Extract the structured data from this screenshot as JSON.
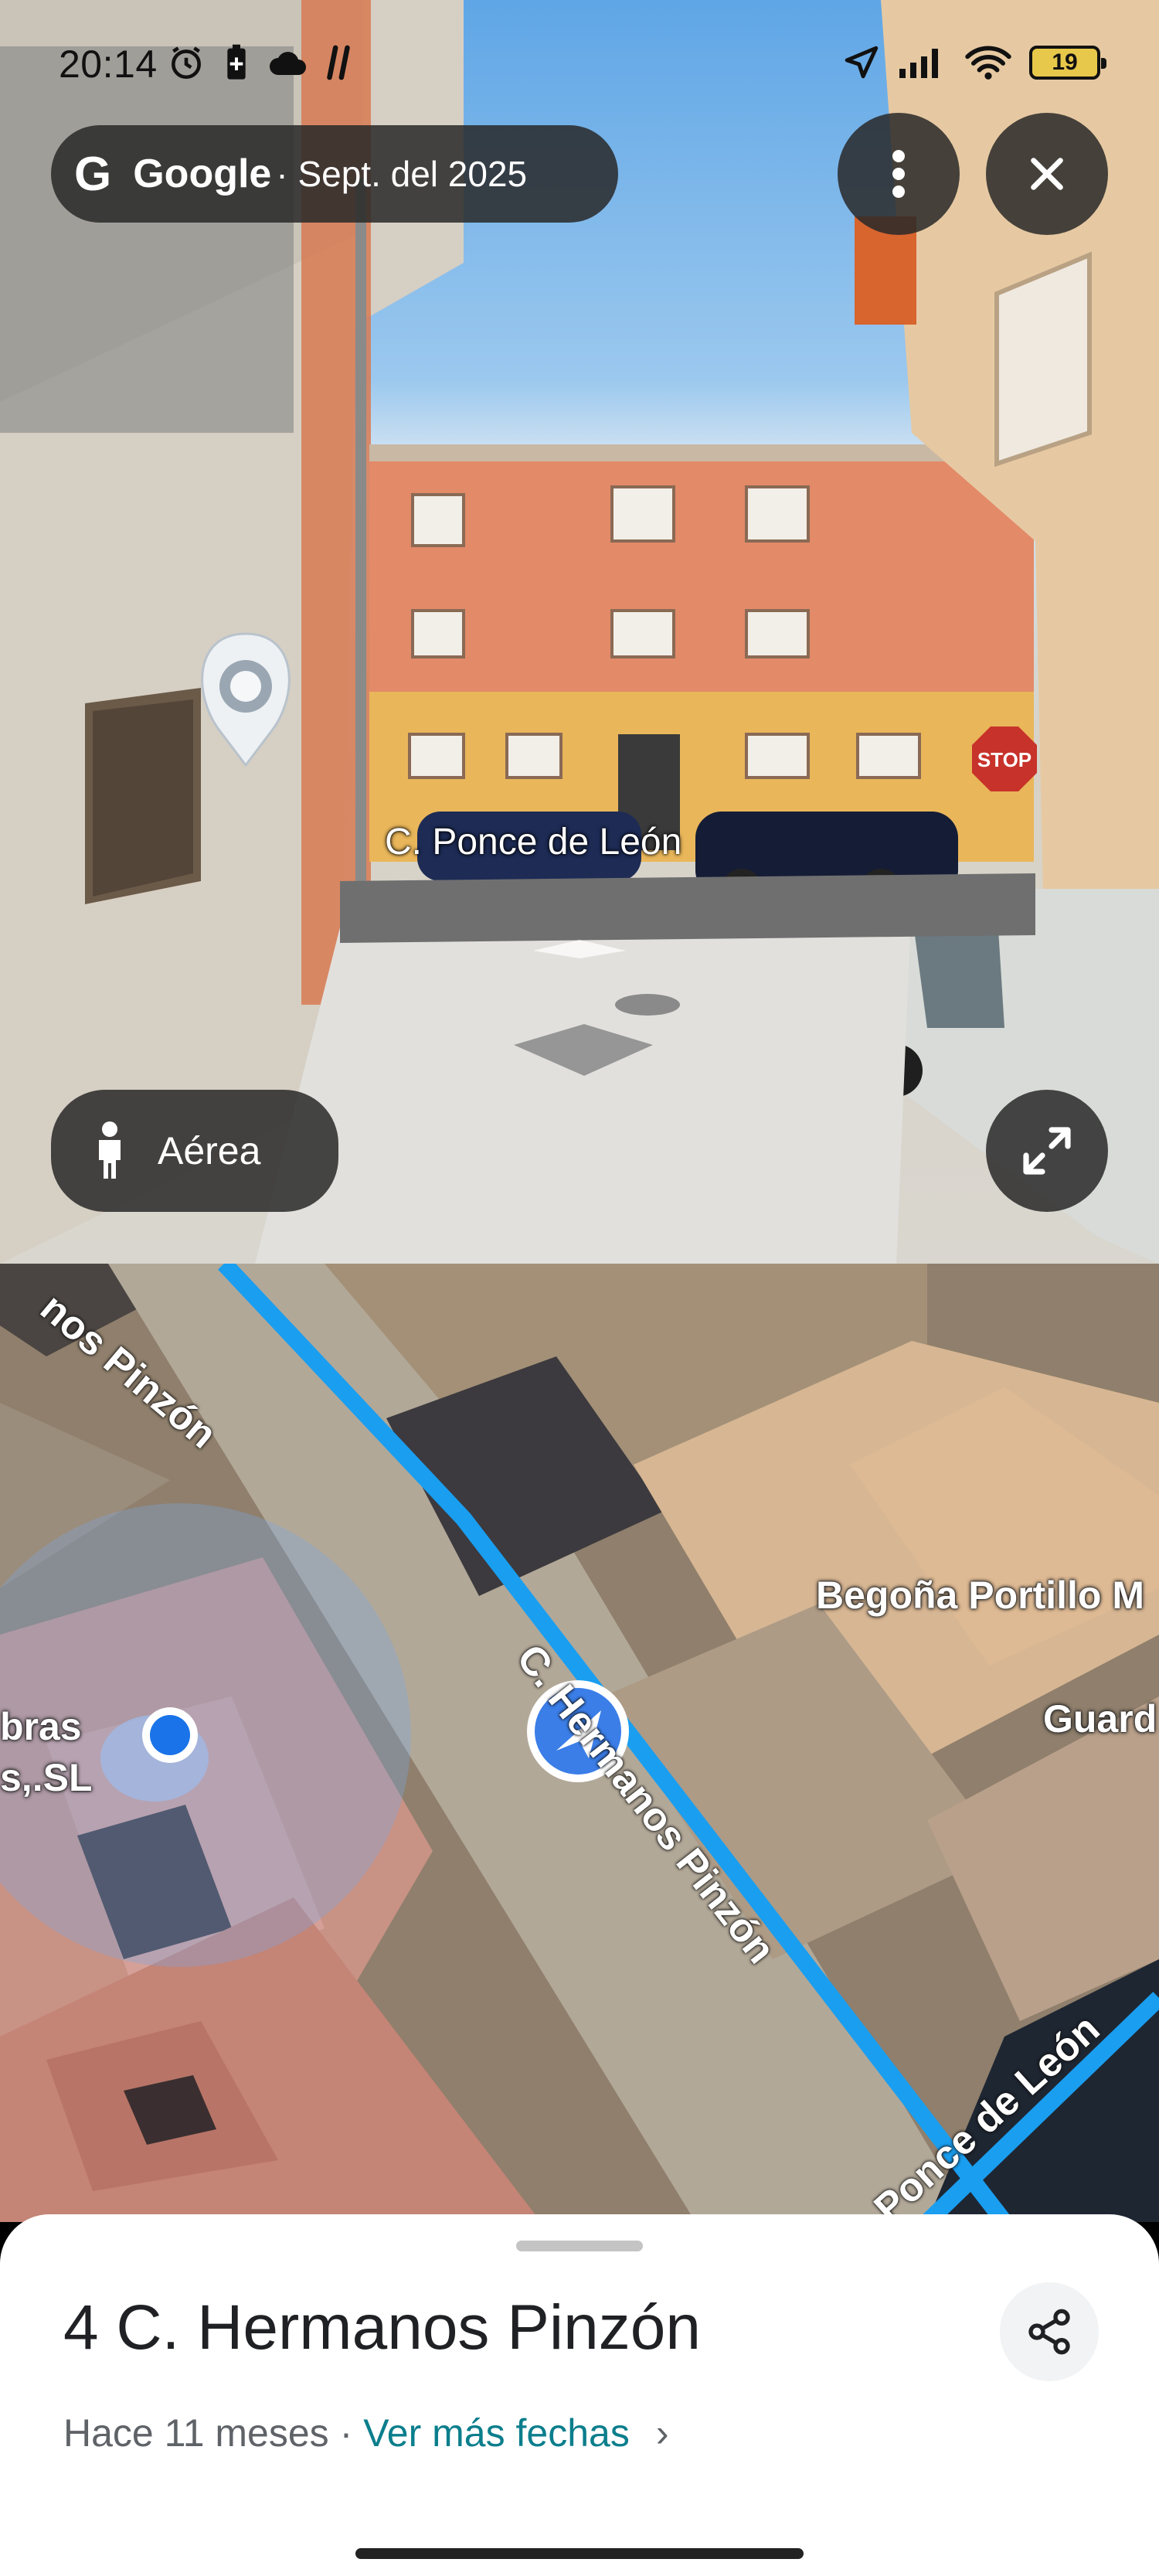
{
  "status_bar": {
    "time": "20:14",
    "battery": "19",
    "left_icons": [
      "alarm-icon",
      "battery-saver-icon",
      "cloud-icon",
      "app-icon"
    ],
    "right_icons": [
      "location-arrow-icon",
      "cellular-signal-icon",
      "wifi-icon"
    ]
  },
  "street_view": {
    "source_logo": "G",
    "source_brand": "Google",
    "capture_date": "· Sept. del 2025",
    "street_label": "C. Ponce de León",
    "aerial_button": "Aérea",
    "menu_icon": "more-vert-icon",
    "close_icon": "close-icon",
    "expand_icon": "expand-icon",
    "person_icon": "pegman-icon",
    "place_marker_icon": "place-marker-icon"
  },
  "map": {
    "labels": {
      "business_1": "Begoña Portillo M",
      "business_2": "Guard",
      "business_3_line1": "bras",
      "business_3_line2": "s,.SL"
    },
    "roads": {
      "top": "nos Pinzón",
      "main": "C. Hermanos Pinzón",
      "ponce": "Ponce de León"
    },
    "colors": {
      "route": "#1a9ef0",
      "location_dot": "#1a73e8",
      "accuracy_circle": "#7aa8e6"
    }
  },
  "sheet": {
    "title": "4 C. Hermanos Pinzón",
    "age": "Hace 11 meses ·",
    "more_dates_link": "Ver más fechas",
    "chevron": "›",
    "share_icon": "share-icon",
    "accent": "#0b7e8c"
  }
}
